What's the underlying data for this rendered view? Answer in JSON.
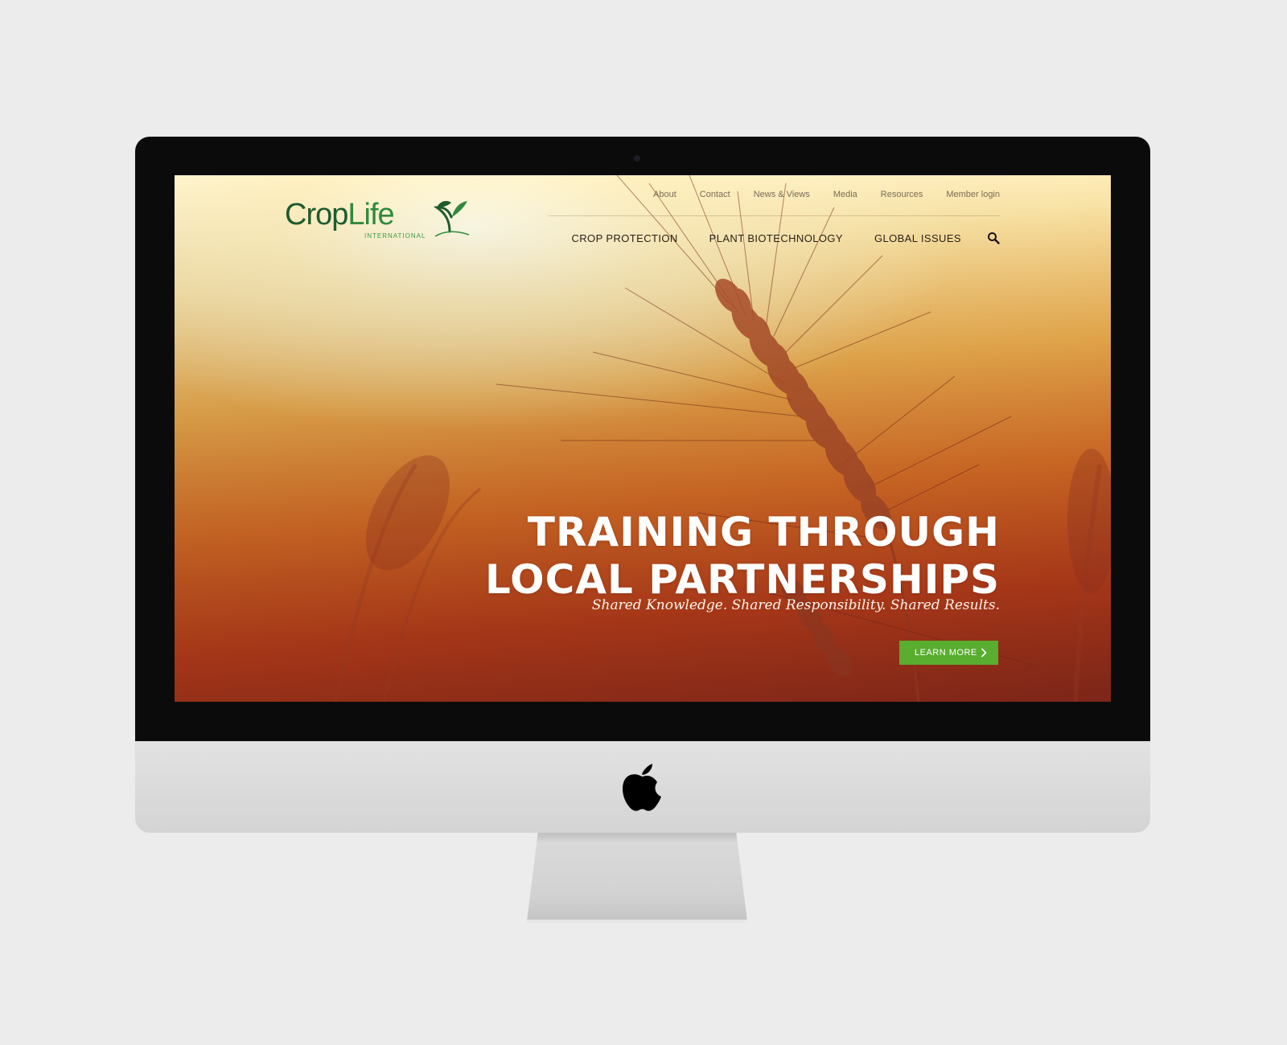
{
  "logo": {
    "brand_part1": "Crop",
    "brand_part2": "Life",
    "tagline": "INTERNATIONAL"
  },
  "utility_nav": [
    "About",
    "Contact",
    "News & Views",
    "Media",
    "Resources",
    "Member login"
  ],
  "main_nav": [
    "CROP PROTECTION",
    "PLANT BIOTECHNOLOGY",
    "GLOBAL ISSUES"
  ],
  "hero": {
    "title_line1": "TRAINING THROUGH",
    "title_line2": "LOCAL PARTNERSHIPS",
    "subtitle": "Shared Knowledge. Shared Responsibility. Shared Results.",
    "cta_label": "LEARN MORE"
  },
  "icons": {
    "search": "search-icon",
    "cta_arrow": "chevron-right-icon",
    "device_logo": "apple-logo-icon"
  },
  "colors": {
    "brand_green_dark": "#1e5b2e",
    "brand_green": "#2f8a3d",
    "cta_green": "#59ad2f",
    "hero_warm": "#eb7a2a"
  }
}
